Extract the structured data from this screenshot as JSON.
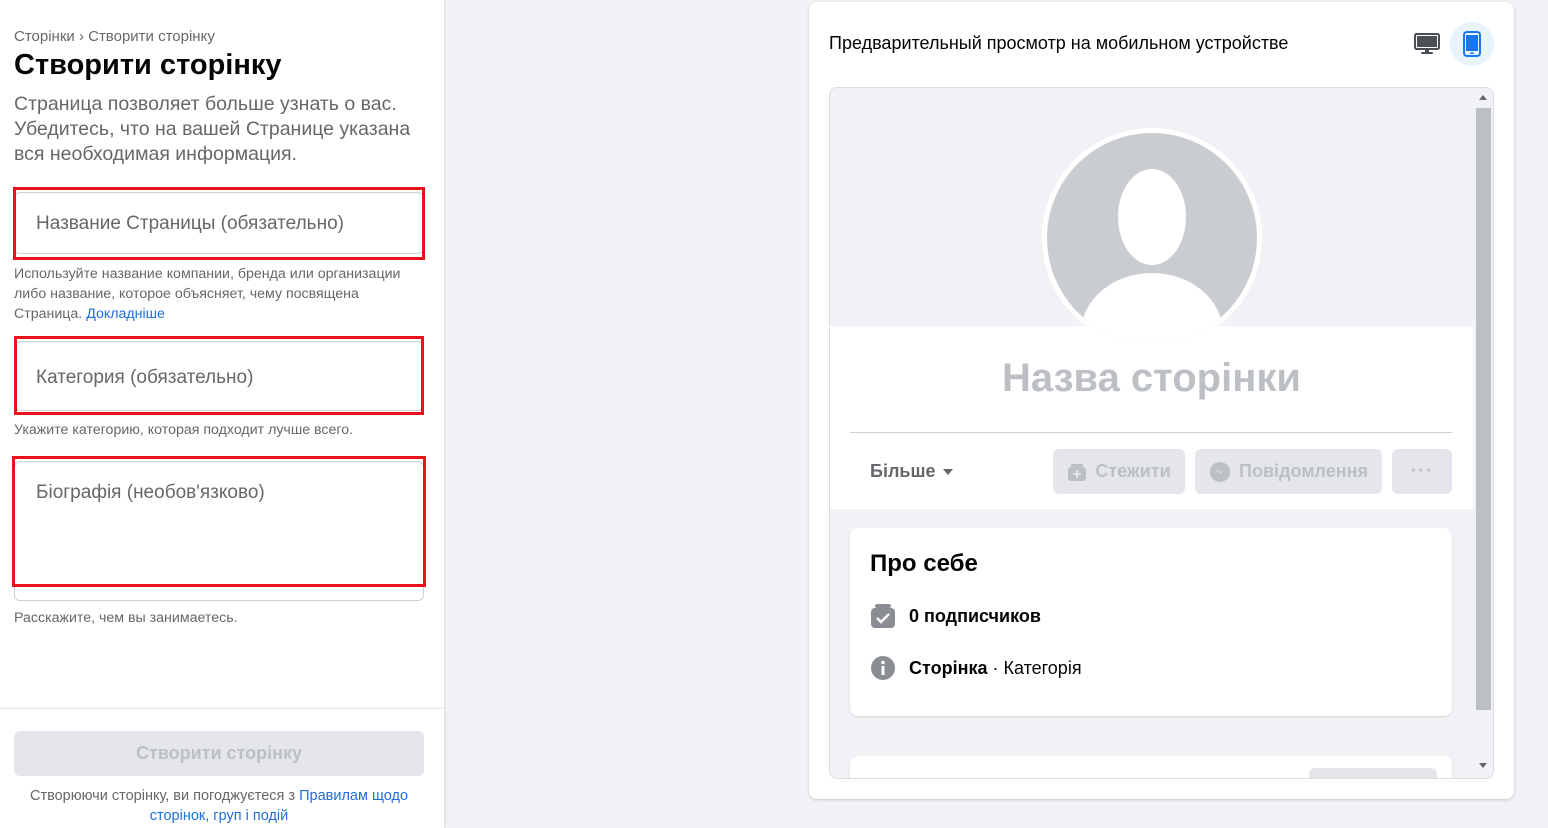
{
  "form": {
    "breadcrumb": "Сторінки › Створити сторінку",
    "title": "Створити сторінку",
    "intro": "Страница позволяет больше узнать о вас. Убедитесь, что на вашей Странице указана вся необходимая информация.",
    "name_placeholder": "Название Страницы (обязательно)",
    "name_hint": "Используйте название компании, бренда или организации либо название, которое объясняет, чему посвящена Страница.",
    "name_hint_link": "Докладніше",
    "category_placeholder": "Категория (обязательно)",
    "category_hint": "Укажите категорию, которая подходит лучше всего.",
    "bio_placeholder": "Біографія (необов'язково)",
    "bio_hint": "Расскажите, чем вы занимаетесь.",
    "create_button": "Створити сторінку",
    "terms_text": "Створюючи сторінку, ви погоджуєтеся з ",
    "terms_link": "Правилам щодо сторінок, груп і подій"
  },
  "preview": {
    "title": "Предварительный просмотр на мобильном устройстве",
    "page_name": "Назва сторінки",
    "more_label": "Більше",
    "follow_label": "Стежити",
    "message_label": "Повідомлення",
    "dots_label": "···",
    "about_title": "Про себе",
    "followers": "0 подписчиков",
    "page_type": "Сторінка",
    "separator": " · ",
    "category": "Категорія"
  },
  "colors": {
    "highlight_red": "#e8141b",
    "link_blue": "#216fdb",
    "active_device": "#1877f2"
  }
}
